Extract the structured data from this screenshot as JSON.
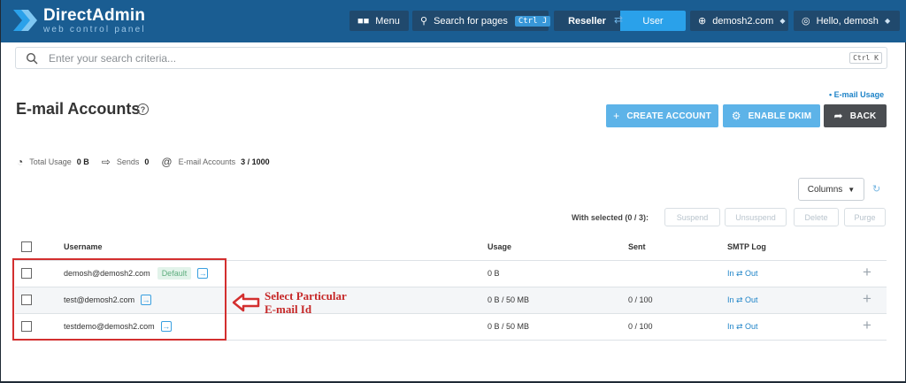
{
  "brand": {
    "name": "DirectAdmin",
    "tagline": "web control panel"
  },
  "topbar": {
    "menu_label": "Menu",
    "search_label": "Search for pages",
    "search_shortcut": "Ctrl J",
    "reseller_label": "Reseller",
    "user_label": "User",
    "domain_label": "demosh2.com",
    "hello_label": "Hello, demosh"
  },
  "search": {
    "placeholder": "Enter your search criteria...",
    "shortcut": "Ctrl K"
  },
  "page": {
    "title": "E-mail Accounts",
    "help_glyph": "?",
    "email_usage_link": "• E-mail Usage",
    "create_label": "CREATE ACCOUNT",
    "dkim_label": "ENABLE DKIM",
    "back_label": "BACK"
  },
  "stats": {
    "total_usage_label": "Total Usage",
    "total_usage_value": "0 B",
    "sends_label": "Sends",
    "sends_value": "0",
    "accounts_label": "E-mail Accounts",
    "accounts_value": "3 / 1000"
  },
  "toolbar": {
    "columns_label": "Columns",
    "with_selected": "With selected (0 / 3):",
    "suspend": "Suspend",
    "unsuspend": "Unsuspend",
    "delete": "Delete",
    "purge": "Purge"
  },
  "table": {
    "headers": {
      "username": "Username",
      "usage": "Usage",
      "sent": "Sent",
      "smtp": "SMTP Log"
    },
    "rows": [
      {
        "username": "demosh@demosh2.com",
        "badge": "Default",
        "usage": "0 B",
        "sent": "",
        "smtp": "In ⇄ Out"
      },
      {
        "username": "test@demosh2.com",
        "badge": "",
        "usage": "0 B / 50 MB",
        "sent": "0 / 100",
        "smtp": "In ⇄ Out"
      },
      {
        "username": "testdemo@demosh2.com",
        "badge": "",
        "usage": "0 B / 50 MB",
        "sent": "0 / 100",
        "smtp": "In ⇄ Out"
      }
    ]
  },
  "annotation": {
    "line1": "Select Particular",
    "line2": "E-mail Id"
  },
  "colors": {
    "topbar": "#1a5d92",
    "accent": "#2aa1ea",
    "annotation": "#d32f2f"
  }
}
